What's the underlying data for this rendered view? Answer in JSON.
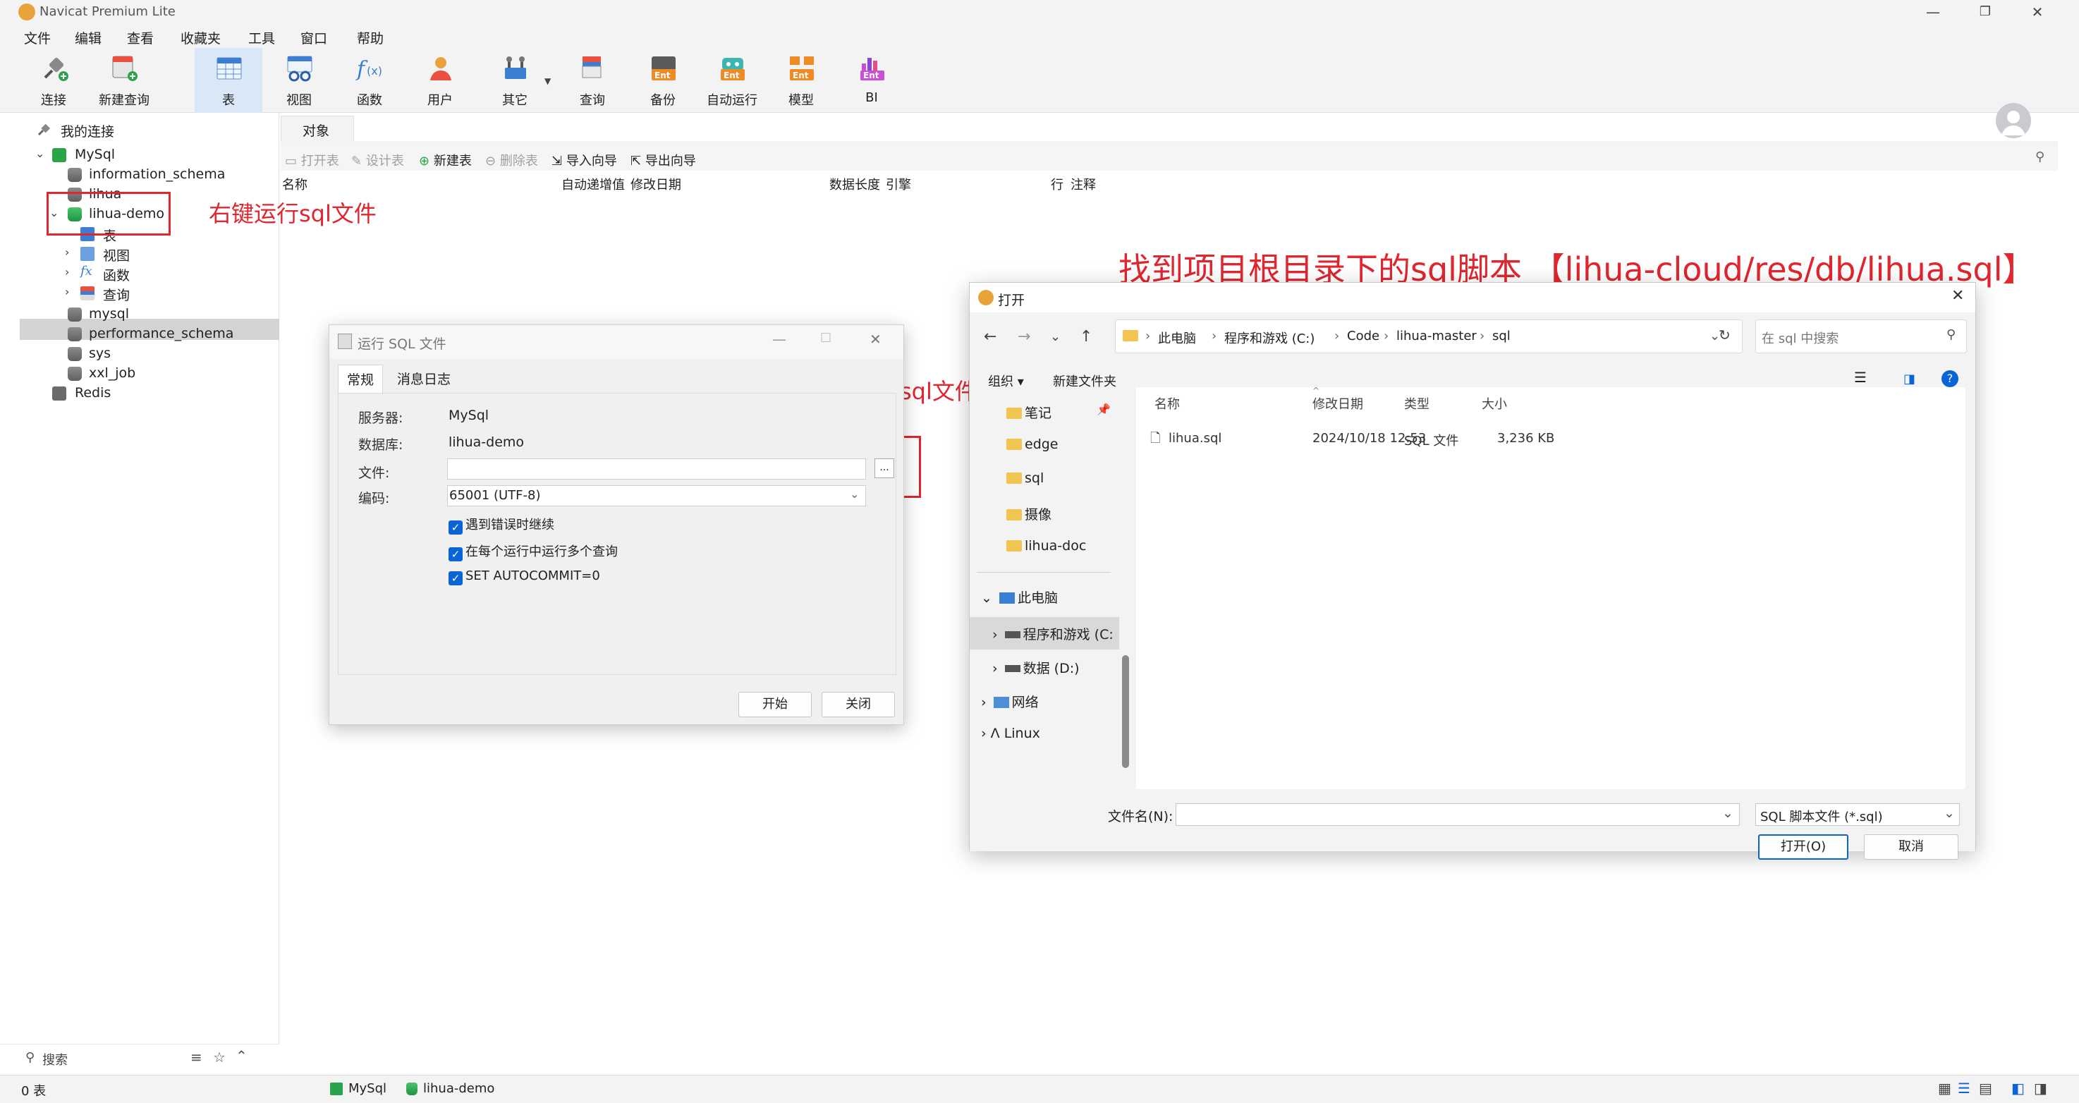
{
  "app": {
    "title": "Navicat Premium Lite"
  },
  "menu": [
    "文件",
    "编辑",
    "查看",
    "收藏夹",
    "工具",
    "窗口",
    "帮助"
  ],
  "toolbar": [
    {
      "label": "连接",
      "icon": "plug-icon"
    },
    {
      "label": "新建查询",
      "icon": "new-query-icon"
    },
    {
      "label": "表",
      "icon": "table-icon"
    },
    {
      "label": "视图",
      "icon": "view-icon"
    },
    {
      "label": "函数",
      "icon": "function-icon"
    },
    {
      "label": "用户",
      "icon": "user-icon"
    },
    {
      "label": "其它",
      "icon": "tools-icon"
    },
    {
      "label": "查询",
      "icon": "query-icon"
    },
    {
      "label": "备份",
      "icon": "backup-icon"
    },
    {
      "label": "自动运行",
      "icon": "robot-icon"
    },
    {
      "label": "模型",
      "icon": "model-icon"
    },
    {
      "label": "BI",
      "icon": "bi-chart-icon"
    }
  ],
  "tree": {
    "root": "我的连接",
    "connection": "MySql",
    "dbs": [
      "information_schema",
      "lihua",
      "lihua-demo"
    ],
    "children": [
      "表",
      "视图",
      "函数",
      "查询"
    ],
    "more_dbs": [
      "mysql",
      "performance_schema",
      "sys",
      "xxl_job"
    ],
    "redis": "Redis"
  },
  "left_search": {
    "placeholder": "搜索"
  },
  "object": {
    "tab": "对象",
    "toolbar": [
      {
        "label": "打开表",
        "disabled": true
      },
      {
        "label": "设计表",
        "disabled": true
      },
      {
        "label": "新建表",
        "disabled": false
      },
      {
        "label": "删除表",
        "disabled": true
      },
      {
        "label": "导入向导",
        "disabled": false
      },
      {
        "label": "导出向导",
        "disabled": false
      }
    ],
    "columns": [
      "名称",
      "自动递增值",
      "修改日期",
      "数据长度",
      "引擎",
      "行",
      "注释"
    ]
  },
  "status": {
    "count": "0 表",
    "connection": "MySql",
    "db": "lihua-demo"
  },
  "annotations": {
    "right_click": "右键运行sql文件",
    "click_choose": "点击选择sql文件",
    "find_script": "找到项目根目录下的sql脚本 【lihua-cloud/res/db/lihua.sql】"
  },
  "run_dialog": {
    "title": "运行 SQL 文件",
    "tabs": [
      "常规",
      "消息日志"
    ],
    "server_label": "服务器:",
    "server": "MySql",
    "db_label": "数据库:",
    "db": "lihua-demo",
    "file_label": "文件:",
    "file": "",
    "browse": "...",
    "encoding_label": "编码:",
    "encoding": "65001 (UTF-8)",
    "checks": [
      "遇到错误时继续",
      "在每个运行中运行多个查询",
      "SET AUTOCOMMIT=0"
    ],
    "start": "开始",
    "close": "关闭"
  },
  "open_dialog": {
    "title": "打开",
    "breadcrumb": [
      "此电脑",
      "程序和游戏 (C:)",
      "Code",
      "lihua-master",
      "sql"
    ],
    "search_placeholder": "在 sql 中搜索",
    "organize": "组织 ▾",
    "new_folder": "新建文件夹",
    "quick": [
      "笔记",
      "edge",
      "sql",
      "摄像",
      "lihua-doc"
    ],
    "this_pc": "此电脑",
    "drives": [
      "程序和游戏 (C:",
      "数据 (D:)"
    ],
    "network": "网络",
    "linux": "Linux",
    "headers": [
      "名称",
      "修改日期",
      "类型",
      "大小"
    ],
    "files": [
      {
        "name": "lihua.sql",
        "date": "2024/10/18 12:53",
        "type": "SQL 文件",
        "size": "3,236 KB"
      }
    ],
    "filename_label": "文件名(N):",
    "filter": "SQL 脚本文件 (*.sql)",
    "open_btn": "打开(O)",
    "cancel_btn": "取消"
  }
}
